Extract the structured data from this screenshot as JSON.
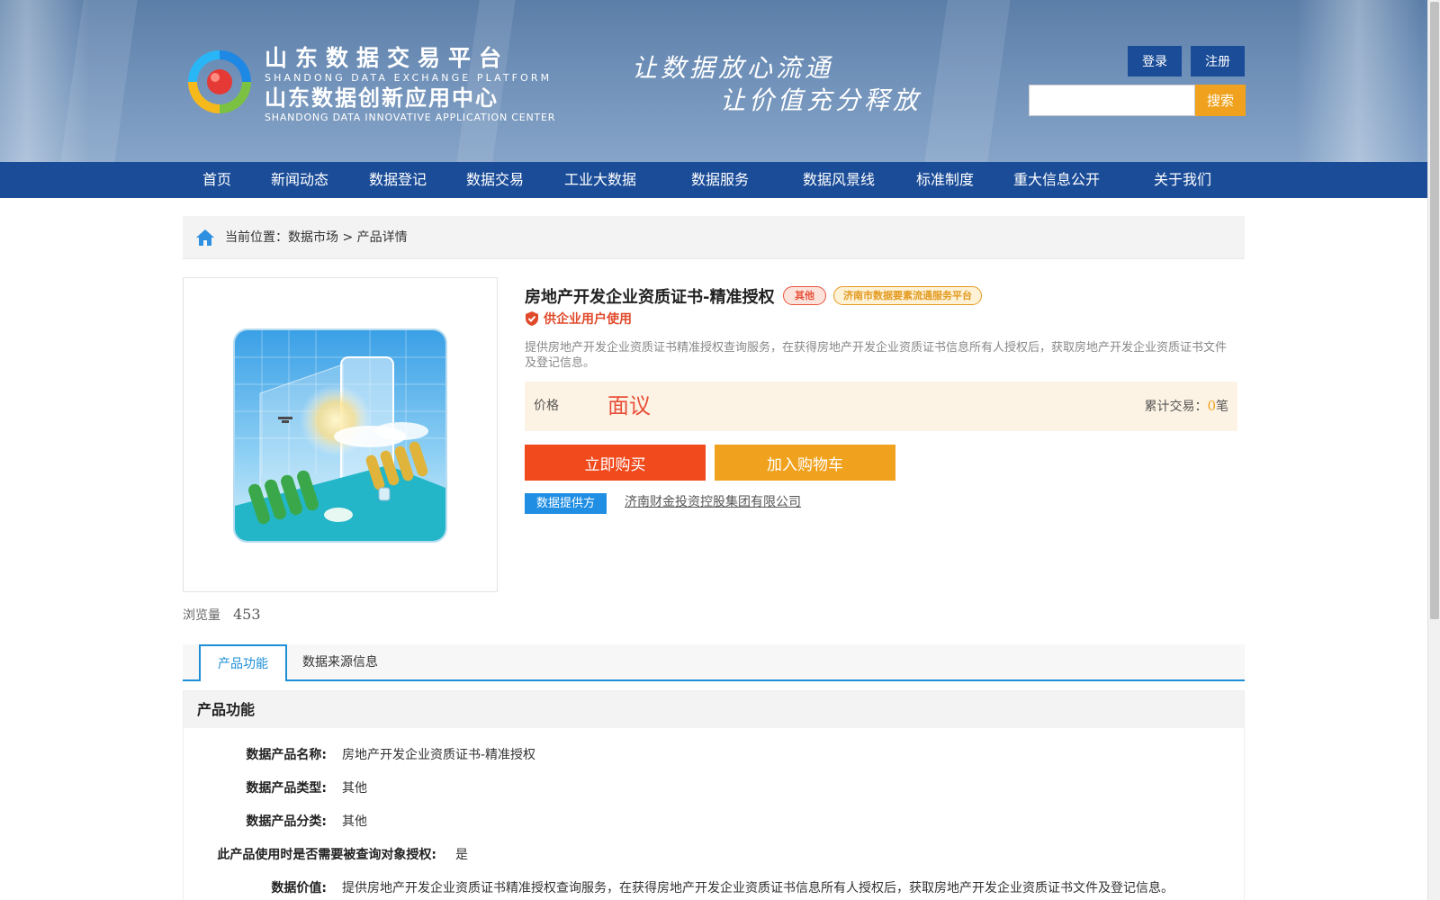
{
  "header": {
    "brand_cn_1": "山东数据交易平台",
    "brand_en_1": "SHANDONG DATA EXCHANGE PLATFORM",
    "brand_cn_2": "山东数据创新应用中心",
    "brand_en_2": "SHANDONG DATA INNOVATIVE APPLICATION CENTER",
    "slogan_1": "让数据放心流通",
    "slogan_2": "让价值充分释放",
    "login_label": "登录",
    "register_label": "注册",
    "search_placeholder": "",
    "search_label": "搜索"
  },
  "nav": [
    "首页",
    "新闻动态",
    "数据登记",
    "数据交易",
    "工业大数据",
    "数据服务",
    "数据风景线",
    "标准制度",
    "重大信息公开",
    "关于我们"
  ],
  "breadcrumb": {
    "prefix": "当前位置：",
    "parent": "数据市场",
    "sep": ">",
    "current": "产品详情"
  },
  "product": {
    "title": "房地产开发企业资质证书-精准授权",
    "tag_category": "其他",
    "tag_platform": "济南市数据要素流通服务平台",
    "enterprise_only": "供企业用户使用",
    "description": "提供房地产开发企业资质证书精准授权查询服务，在获得房地产开发企业资质证书信息所有人授权后，获取房地产开发企业资质证书文件及登记信息。",
    "price_label": "价格",
    "price_value": "面议",
    "trade_label": "累计交易：",
    "trade_count": "0",
    "trade_unit": "笔",
    "buy_label": "立即购买",
    "cart_label": "加入购物车",
    "provider_label": "数据提供方",
    "provider_name": "济南财金投资控股集团有限公司",
    "views_label": "浏览量",
    "views_count": "453"
  },
  "tabs": [
    "产品功能",
    "数据来源信息"
  ],
  "section": {
    "title": "产品功能",
    "rows": [
      {
        "k": "数据产品名称:",
        "v": "房地产开发企业资质证书-精准授权"
      },
      {
        "k": "数据产品类型:",
        "v": "其他"
      },
      {
        "k": "数据产品分类:",
        "v": "其他"
      },
      {
        "k": "此产品使用时是否需要被查询对象授权:",
        "v": "是"
      },
      {
        "k": "数据价值:",
        "v": "提供房地产开发企业资质证书精准授权查询服务，在获得房地产开发企业资质证书信息所有人授权后，获取房地产开发企业资质证书文件及登记信息。"
      }
    ]
  },
  "colors": {
    "nav_blue": "#1a4c98",
    "accent_orange": "#f0a21e",
    "buy_red": "#f04a1d",
    "tab_blue": "#1d8fd6"
  }
}
